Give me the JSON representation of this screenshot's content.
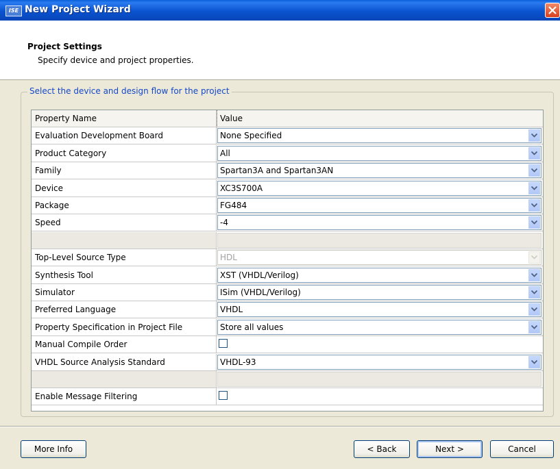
{
  "window": {
    "title": "New Project Wizard",
    "icon_text": "ISE"
  },
  "header": {
    "title": "Project Settings",
    "subtitle": "Specify device and project properties."
  },
  "group": {
    "legend": "Select the device and design flow for the project"
  },
  "table": {
    "columns": [
      "Property Name",
      "Value"
    ],
    "rows": [
      {
        "name": "Evaluation Development Board",
        "type": "combo",
        "value": "None Specified"
      },
      {
        "name": "Product Category",
        "type": "combo",
        "value": "All"
      },
      {
        "name": "Family",
        "type": "combo",
        "value": "Spartan3A and Spartan3AN"
      },
      {
        "name": "Device",
        "type": "combo",
        "value": "XC3S700A"
      },
      {
        "name": "Package",
        "type": "combo",
        "value": "FG484"
      },
      {
        "name": "Speed",
        "type": "combo",
        "value": "-4"
      },
      {
        "name": "",
        "type": "blank",
        "value": ""
      },
      {
        "name": "Top-Level Source Type",
        "type": "combo-disabled",
        "value": "HDL"
      },
      {
        "name": "Synthesis Tool",
        "type": "combo",
        "value": "XST (VHDL/Verilog)"
      },
      {
        "name": "Simulator",
        "type": "combo",
        "value": "ISim (VHDL/Verilog)"
      },
      {
        "name": "Preferred Language",
        "type": "combo",
        "value": "VHDL"
      },
      {
        "name": "Property Specification in Project File",
        "type": "combo",
        "value": "Store all values"
      },
      {
        "name": "Manual Compile Order",
        "type": "checkbox",
        "value": false
      },
      {
        "name": "VHDL Source Analysis Standard",
        "type": "combo",
        "value": "VHDL-93"
      },
      {
        "name": "",
        "type": "blank",
        "value": ""
      },
      {
        "name": "Enable Message Filtering",
        "type": "checkbox",
        "value": false
      }
    ]
  },
  "buttons": {
    "more_info": "More Info",
    "back": "< Back",
    "next": "Next >",
    "cancel": "Cancel"
  },
  "colors": {
    "titlebar": "#0a53d0",
    "dialog_bg": "#ece9d8",
    "legend_text": "#1448c8",
    "close_button": "#d8401e"
  }
}
